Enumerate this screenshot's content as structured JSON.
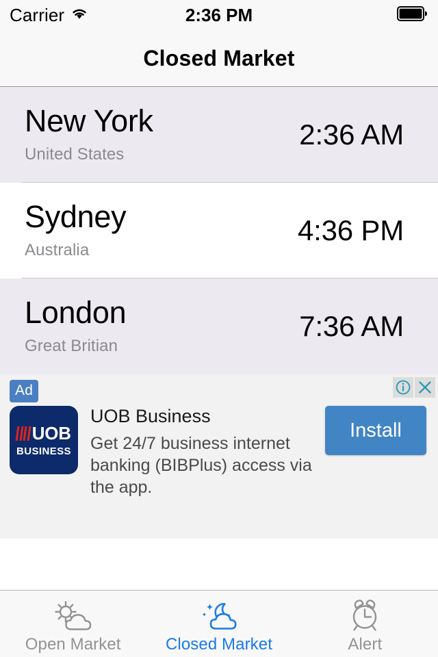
{
  "status_bar": {
    "carrier": "Carrier",
    "wifi_icon": "wifi-icon",
    "time": "2:36 PM",
    "battery_icon": "battery-full-icon"
  },
  "nav": {
    "title": "Closed Market"
  },
  "markets": [
    {
      "city": "New York",
      "country": "United States",
      "time": "2:36 AM"
    },
    {
      "city": "Sydney",
      "country": "Australia",
      "time": "4:36 PM"
    },
    {
      "city": "London",
      "country": "Great Britian",
      "time": "7:36 AM"
    }
  ],
  "ad": {
    "badge": "Ad",
    "info_icon": "info-icon",
    "close_icon": "close-icon",
    "logo_name": "UOB",
    "logo_sub": "BUSINESS",
    "title": "UOB Business",
    "description": "Get 24/7 business internet banking (BIBPlus) access via the app.",
    "cta": "Install",
    "badge_color": "#4a7fc1",
    "cta_color": "#4285c4",
    "control_color": "#2a9cb5"
  },
  "tabs": [
    {
      "label": "Open Market",
      "icon": "sun-cloud-icon",
      "active": false
    },
    {
      "label": "Closed Market",
      "icon": "moon-cloud-icon",
      "active": true
    },
    {
      "label": "Alert",
      "icon": "alarm-clock-icon",
      "active": false
    }
  ],
  "colors": {
    "accent": "#1a7ae8",
    "inactive": "#929292",
    "row_alt_bg": "#eceaf0",
    "subtitle": "#8a8a8f"
  }
}
